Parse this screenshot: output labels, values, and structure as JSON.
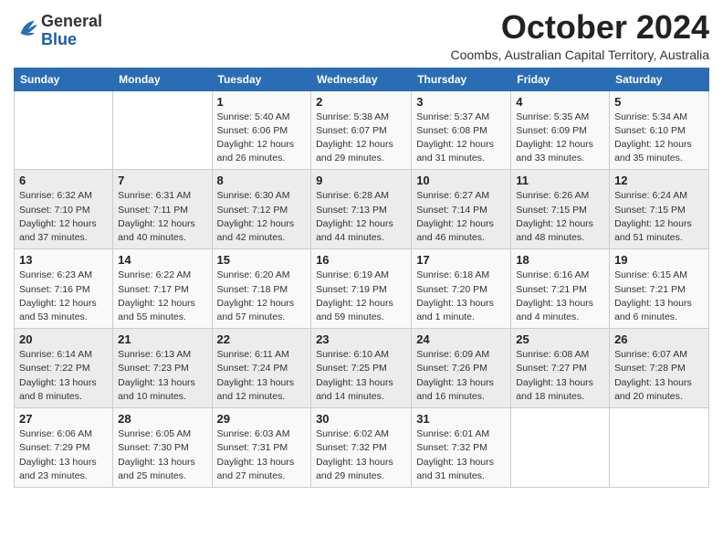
{
  "logo": {
    "general": "General",
    "blue": "Blue"
  },
  "title": "October 2024",
  "subtitle": "Coombs, Australian Capital Territory, Australia",
  "days_of_week": [
    "Sunday",
    "Monday",
    "Tuesday",
    "Wednesday",
    "Thursday",
    "Friday",
    "Saturday"
  ],
  "weeks": [
    [
      {
        "day": "",
        "info": ""
      },
      {
        "day": "",
        "info": ""
      },
      {
        "day": "1",
        "info": "Sunrise: 5:40 AM\nSunset: 6:06 PM\nDaylight: 12 hours\nand 26 minutes."
      },
      {
        "day": "2",
        "info": "Sunrise: 5:38 AM\nSunset: 6:07 PM\nDaylight: 12 hours\nand 29 minutes."
      },
      {
        "day": "3",
        "info": "Sunrise: 5:37 AM\nSunset: 6:08 PM\nDaylight: 12 hours\nand 31 minutes."
      },
      {
        "day": "4",
        "info": "Sunrise: 5:35 AM\nSunset: 6:09 PM\nDaylight: 12 hours\nand 33 minutes."
      },
      {
        "day": "5",
        "info": "Sunrise: 5:34 AM\nSunset: 6:10 PM\nDaylight: 12 hours\nand 35 minutes."
      }
    ],
    [
      {
        "day": "6",
        "info": "Sunrise: 6:32 AM\nSunset: 7:10 PM\nDaylight: 12 hours\nand 37 minutes."
      },
      {
        "day": "7",
        "info": "Sunrise: 6:31 AM\nSunset: 7:11 PM\nDaylight: 12 hours\nand 40 minutes."
      },
      {
        "day": "8",
        "info": "Sunrise: 6:30 AM\nSunset: 7:12 PM\nDaylight: 12 hours\nand 42 minutes."
      },
      {
        "day": "9",
        "info": "Sunrise: 6:28 AM\nSunset: 7:13 PM\nDaylight: 12 hours\nand 44 minutes."
      },
      {
        "day": "10",
        "info": "Sunrise: 6:27 AM\nSunset: 7:14 PM\nDaylight: 12 hours\nand 46 minutes."
      },
      {
        "day": "11",
        "info": "Sunrise: 6:26 AM\nSunset: 7:15 PM\nDaylight: 12 hours\nand 48 minutes."
      },
      {
        "day": "12",
        "info": "Sunrise: 6:24 AM\nSunset: 7:15 PM\nDaylight: 12 hours\nand 51 minutes."
      }
    ],
    [
      {
        "day": "13",
        "info": "Sunrise: 6:23 AM\nSunset: 7:16 PM\nDaylight: 12 hours\nand 53 minutes."
      },
      {
        "day": "14",
        "info": "Sunrise: 6:22 AM\nSunset: 7:17 PM\nDaylight: 12 hours\nand 55 minutes."
      },
      {
        "day": "15",
        "info": "Sunrise: 6:20 AM\nSunset: 7:18 PM\nDaylight: 12 hours\nand 57 minutes."
      },
      {
        "day": "16",
        "info": "Sunrise: 6:19 AM\nSunset: 7:19 PM\nDaylight: 12 hours\nand 59 minutes."
      },
      {
        "day": "17",
        "info": "Sunrise: 6:18 AM\nSunset: 7:20 PM\nDaylight: 13 hours\nand 1 minute."
      },
      {
        "day": "18",
        "info": "Sunrise: 6:16 AM\nSunset: 7:21 PM\nDaylight: 13 hours\nand 4 minutes."
      },
      {
        "day": "19",
        "info": "Sunrise: 6:15 AM\nSunset: 7:21 PM\nDaylight: 13 hours\nand 6 minutes."
      }
    ],
    [
      {
        "day": "20",
        "info": "Sunrise: 6:14 AM\nSunset: 7:22 PM\nDaylight: 13 hours\nand 8 minutes."
      },
      {
        "day": "21",
        "info": "Sunrise: 6:13 AM\nSunset: 7:23 PM\nDaylight: 13 hours\nand 10 minutes."
      },
      {
        "day": "22",
        "info": "Sunrise: 6:11 AM\nSunset: 7:24 PM\nDaylight: 13 hours\nand 12 minutes."
      },
      {
        "day": "23",
        "info": "Sunrise: 6:10 AM\nSunset: 7:25 PM\nDaylight: 13 hours\nand 14 minutes."
      },
      {
        "day": "24",
        "info": "Sunrise: 6:09 AM\nSunset: 7:26 PM\nDaylight: 13 hours\nand 16 minutes."
      },
      {
        "day": "25",
        "info": "Sunrise: 6:08 AM\nSunset: 7:27 PM\nDaylight: 13 hours\nand 18 minutes."
      },
      {
        "day": "26",
        "info": "Sunrise: 6:07 AM\nSunset: 7:28 PM\nDaylight: 13 hours\nand 20 minutes."
      }
    ],
    [
      {
        "day": "27",
        "info": "Sunrise: 6:06 AM\nSunset: 7:29 PM\nDaylight: 13 hours\nand 23 minutes."
      },
      {
        "day": "28",
        "info": "Sunrise: 6:05 AM\nSunset: 7:30 PM\nDaylight: 13 hours\nand 25 minutes."
      },
      {
        "day": "29",
        "info": "Sunrise: 6:03 AM\nSunset: 7:31 PM\nDaylight: 13 hours\nand 27 minutes."
      },
      {
        "day": "30",
        "info": "Sunrise: 6:02 AM\nSunset: 7:32 PM\nDaylight: 13 hours\nand 29 minutes."
      },
      {
        "day": "31",
        "info": "Sunrise: 6:01 AM\nSunset: 7:32 PM\nDaylight: 13 hours\nand 31 minutes."
      },
      {
        "day": "",
        "info": ""
      },
      {
        "day": "",
        "info": ""
      }
    ]
  ]
}
